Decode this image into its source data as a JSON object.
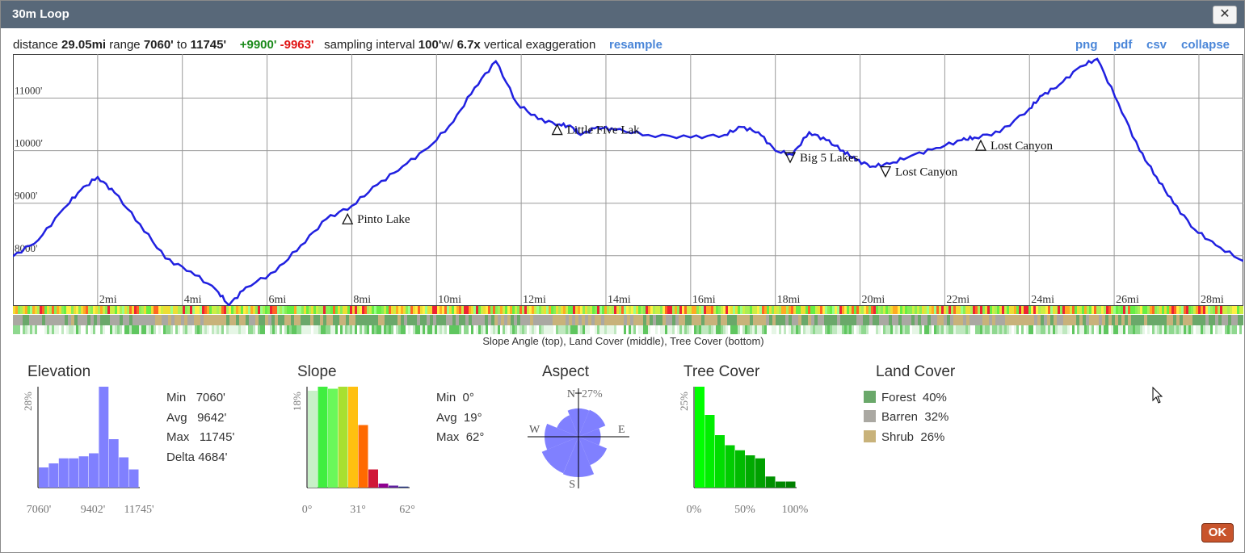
{
  "window": {
    "title": "30m Loop",
    "close_glyph": "✕"
  },
  "summary": {
    "distance_label": "distance",
    "distance": "29.05mi",
    "range_label": "range",
    "range_min": "7060'",
    "range_to": "to",
    "range_max": "11745'",
    "gain": "+9900'",
    "loss": "-9963'",
    "sampling_label": "sampling interval",
    "sampling": "100'",
    "sampling_w": "w/",
    "exaggeration": "6.7x",
    "exaggeration_label": "vertical exaggeration",
    "resample": "resample"
  },
  "export_links": {
    "png": "png",
    "pdf": "pdf",
    "csv": "csv",
    "collapse": "collapse"
  },
  "profile": {
    "y_labels": [
      "11000'",
      "10000'",
      "9000'",
      "8000'"
    ],
    "x_labels": [
      "2mi",
      "4mi",
      "6mi",
      "8mi",
      "10mi",
      "12mi",
      "14mi",
      "16mi",
      "18mi",
      "20mi",
      "22mi",
      "24mi",
      "26mi",
      "28mi"
    ],
    "line_color": "#2020e0",
    "waypoints": [
      {
        "name": "Pinto Lake",
        "dir": "up"
      },
      {
        "name": "Little Five Lak",
        "dir": "up"
      },
      {
        "name": "Big 5 Lakes",
        "dir": "down"
      },
      {
        "name": "Lost Canyon",
        "dir": "down"
      },
      {
        "name": "Lost Canyon",
        "dir": "up"
      }
    ],
    "caption": "Slope Angle (top), Land Cover (middle), Tree Cover (bottom)"
  },
  "chart_data": {
    "type": "line",
    "title": "",
    "xlabel": "",
    "ylabel": "",
    "x_unit": "mi",
    "y_unit": "ft",
    "xlim": [
      0,
      29.05
    ],
    "ylim": [
      7060,
      11745
    ],
    "x": [
      0,
      0.6,
      1.2,
      1.6,
      2.0,
      2.4,
      3.0,
      3.6,
      4.2,
      4.8,
      5.1,
      5.5,
      6.2,
      6.8,
      7.4,
      8.0,
      8.6,
      9.2,
      9.8,
      10.4,
      10.9,
      11.4,
      11.9,
      12.4,
      12.9,
      13.2,
      13.4,
      13.8,
      14.2,
      15.0,
      16.0,
      16.8,
      17.2,
      17.6,
      18.0,
      18.4,
      18.8,
      19.2,
      19.6,
      19.9,
      20.3,
      20.7,
      21.2,
      21.8,
      22.4,
      22.7,
      23.3,
      24.0,
      24.3,
      24.7,
      25.2,
      25.6,
      26.1,
      26.6,
      27.0,
      27.4,
      27.9,
      28.4,
      29.05
    ],
    "y": [
      7990,
      8300,
      8900,
      9250,
      9500,
      9200,
      8600,
      7950,
      7700,
      7350,
      7060,
      7400,
      7700,
      8200,
      8700,
      8950,
      9350,
      9700,
      10050,
      10550,
      11200,
      11700,
      10900,
      10600,
      10500,
      10450,
      10300,
      10450,
      10400,
      10300,
      10250,
      10300,
      10450,
      10350,
      10000,
      9920,
      10350,
      10200,
      10000,
      9820,
      9700,
      9750,
      9900,
      10050,
      10200,
      10250,
      10350,
      10800,
      11050,
      11250,
      11600,
      11745,
      10900,
      10000,
      9500,
      9000,
      8500,
      8200,
      7900
    ],
    "series": [
      {
        "name": "",
        "color": "#2020e0"
      }
    ],
    "grid": true
  },
  "elevation": {
    "title": "Elevation",
    "y_max_label": "28%",
    "x_labels": [
      "7060'",
      "9402'",
      "11745'"
    ],
    "bar_color": "#8080ff",
    "bars": [
      0.2,
      0.24,
      0.29,
      0.29,
      0.31,
      0.34,
      1.0,
      0.48,
      0.3,
      0.18
    ],
    "stats": [
      {
        "label": "Min",
        "value": "7060'"
      },
      {
        "label": "Avg",
        "value": "9642'"
      },
      {
        "label": "Max",
        "value": "11745'"
      },
      {
        "label": "Delta",
        "value": "4684'"
      }
    ]
  },
  "slope": {
    "title": "Slope",
    "y_max_label": "18%",
    "x_labels": [
      "0°",
      "31°",
      "62°"
    ],
    "bars": [
      {
        "v": 0.96,
        "color": "#c8f0c8"
      },
      {
        "v": 1.0,
        "color": "#40ee40"
      },
      {
        "v": 0.98,
        "color": "#6af85a"
      },
      {
        "v": 1.0,
        "color": "#a8e030"
      },
      {
        "v": 1.0,
        "color": "#ffc010"
      },
      {
        "v": 0.62,
        "color": "#ff6a00"
      },
      {
        "v": 0.18,
        "color": "#d01838"
      },
      {
        "v": 0.04,
        "color": "#900090"
      },
      {
        "v": 0.02,
        "color": "#6020a0"
      },
      {
        "v": 0.01,
        "color": "#203080"
      }
    ],
    "stats": [
      {
        "label": "Min",
        "value": "0°"
      },
      {
        "label": "Avg",
        "value": "19°"
      },
      {
        "label": "Max",
        "value": "62°"
      }
    ]
  },
  "aspect": {
    "title": "Aspect",
    "n_label": "N",
    "pct_label": "27%",
    "e_label": "E",
    "w_label": "W",
    "s_label": "S",
    "fill": "#8080ff",
    "petals": [
      0.7,
      0.72,
      0.55,
      0.76,
      1.0,
      0.98,
      0.84,
      0.58
    ]
  },
  "tree_cover": {
    "title": "Tree Cover",
    "y_max_label": "25%",
    "x_labels": [
      "0%",
      "50%",
      "100%"
    ],
    "bars": [
      {
        "v": 1.0,
        "color": "#00ff00"
      },
      {
        "v": 0.72,
        "color": "#00ee00"
      },
      {
        "v": 0.52,
        "color": "#00dd00"
      },
      {
        "v": 0.42,
        "color": "#00cc00"
      },
      {
        "v": 0.37,
        "color": "#00bb00"
      },
      {
        "v": 0.32,
        "color": "#00aa00"
      },
      {
        "v": 0.29,
        "color": "#00a000"
      },
      {
        "v": 0.11,
        "color": "#009000"
      },
      {
        "v": 0.06,
        "color": "#008800"
      },
      {
        "v": 0.06,
        "color": "#008000"
      }
    ]
  },
  "land_cover": {
    "title": "Land Cover",
    "items": [
      {
        "label": "Forest",
        "pct": "40%",
        "color": "#6aa86a"
      },
      {
        "label": "Barren",
        "pct": "32%",
        "color": "#aaa8a2"
      },
      {
        "label": "Shrub",
        "pct": "26%",
        "color": "#c8b27a"
      }
    ]
  },
  "footer": {
    "ok": "OK"
  }
}
